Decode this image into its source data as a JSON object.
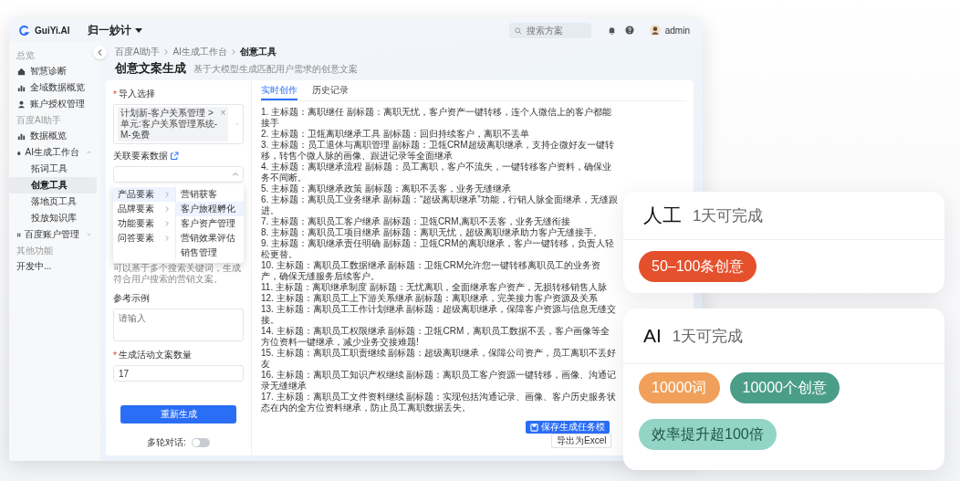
{
  "header": {
    "logo_text": "GuiYi.AI",
    "workspace": "归一妙计",
    "search_placeholder": "搜索方案",
    "user": "admin"
  },
  "sidebar": {
    "sections": [
      {
        "title": "总览",
        "items": [
          {
            "label": "智慧诊断",
            "kind": "nav",
            "selected": false
          },
          {
            "label": "全域数据概览",
            "kind": "nav",
            "selected": false
          },
          {
            "label": "账户授权管理",
            "kind": "nav",
            "selected": false
          }
        ]
      },
      {
        "title": "百度AI助手",
        "items": [
          {
            "label": "数据概览",
            "kind": "nav",
            "selected": false
          },
          {
            "label": "AI生成工作台",
            "kind": "nav",
            "selected": false,
            "expanded": true,
            "children": [
              {
                "label": "拓词工具",
                "selected": false
              },
              {
                "label": "创意工具",
                "selected": true
              },
              {
                "label": "落地页工具",
                "selected": false
              },
              {
                "label": "投放知识库",
                "selected": false
              }
            ]
          },
          {
            "label": "百度账户管理",
            "kind": "nav",
            "selected": false,
            "expanded": false
          }
        ]
      },
      {
        "title": "其他功能",
        "items": [
          {
            "label": "开发中...",
            "kind": "plain",
            "selected": false
          }
        ]
      }
    ]
  },
  "breadcrumb": [
    "百度AI助手",
    "AI生成工作台",
    "创意工具"
  ],
  "page": {
    "title": "创意文案生成",
    "subtitle": "基于大模型生成匹配用户需求的创意文案"
  },
  "form": {
    "import": {
      "mark": "*",
      "label": "导入选择",
      "tag": "计划新-客户关系管理 > 单元:客户关系管理系统-M-免费",
      "tag_close": "×"
    },
    "elements": {
      "label": "关联要素数据",
      "open": true,
      "menu": [
        {
          "label": "产品要素",
          "selected": true
        },
        {
          "label": "品牌要素",
          "selected": false
        },
        {
          "label": "功能要素",
          "selected": false
        },
        {
          "label": "问答要素",
          "selected": false
        }
      ],
      "submenu": [
        {
          "label": "营销获客",
          "selected": false
        },
        {
          "label": "客户旅程孵化",
          "selected": true
        },
        {
          "label": "客户资产管理",
          "selected": false
        },
        {
          "label": "营销效果评估",
          "selected": false
        },
        {
          "label": "销售管理",
          "selected": false
        }
      ]
    },
    "keywords_hint": "可以基于多个搜索关键词，生成符合用户搜索的营销文案。",
    "example": {
      "label": "参考示例",
      "placeholder": "请输入"
    },
    "count": {
      "mark": "*",
      "label": "生成活动文案数量",
      "value": "17"
    },
    "submit": "重新生成",
    "toggle": {
      "label": "多轮对话:",
      "on": false
    }
  },
  "results": {
    "tabs": [
      {
        "label": "实时创作",
        "selected": true
      },
      {
        "label": "历史记录",
        "selected": false
      }
    ],
    "lines": [
      "1. 主标题：离职继任 副标题：离职无忧，客户资产一键转移，连个人微信上的客户都能接手",
      "2. 主标题：卫瓴离职继承工具 副标题：回归持续客户，离职不丢单",
      "3. 主标题：员工退休与离职管理 副标题：卫瓴CRM超级离职继承，支持企微好友一键转移，转售个微人脉的画像、跟进记录等全面继承",
      "4. 主标题：离职继承流程 副标题：员工离职，客户不流失，一键转移客户资料，确保业务不间断。",
      "5. 主标题：离职继承政策 副标题：离职不丢客，业务无缝继承",
      "6. 主标题：离职员工业务继承 副标题：“超级离职继承”功能，行销人脉全面继承，无缝跟进。",
      "7. 主标题：离职员工客户继承 副标题：卫瓴CRM,离职不丢客，业务无缝衔接",
      "8. 主标题：离职员工项目继承 副标题：离职无忧，超级离职继承助力客户无缝接手。",
      "9. 主标题：离职继承责任明确 副标题：卫瓴CRM的离职继承，客户一键转移，负责人轻松更替。",
      "10. 主标题：离职员工数据继承 副标题：卫瓴CRM允许您一键转移离职员工的业务资产，确保无缝服务后续客户。",
      "11. 主标题：离职继承制度 副标题：无忧离职，全面继承客户资产，无损转移销售人脉",
      "12. 主标题：离职员工上下游关系继承 副标题：离职继承，完美接力客户资源及关系",
      "13. 主标题：离职员工工作计划继承 副标题：超级离职继承，保障客户资源与信息无缝交接。",
      "14. 主标题：离职员工权限继承 副标题：卫瓴CRM，离职员工数据不丢，客户画像等全方位资料一键继承，减少业务交接难题!",
      "15. 主标题：离职员工职责继续 副标题：超级离职继承，保障公司资产，员工离职不丢好友",
      "16. 主标题：离职员工知识产权继续 副标题：离职员工客户资源一键转移，画像、沟通记录无缝继承",
      "17. 主标题：离职员工文件资料继续 副标题：实现包括沟通记录、画像、客户历史服务状态在内的全方位资料继承，防止员工离职数据丢失。"
    ],
    "save_button": "保存生成任务模",
    "export_button": "导出为Excel"
  },
  "cards": [
    {
      "title": "人工",
      "subtitle": "1天可完成",
      "pills": [
        {
          "label": "50–100条创意",
          "color": "#e5502c"
        }
      ]
    },
    {
      "title": "AI",
      "subtitle": "1天可完成",
      "pills": [
        {
          "label": "10000词",
          "color": "#f0a05a"
        },
        {
          "label": "10000个创意",
          "color": "#4a9e88"
        },
        {
          "label": "效率提升超100倍",
          "color": "#92d4c5"
        }
      ]
    }
  ]
}
